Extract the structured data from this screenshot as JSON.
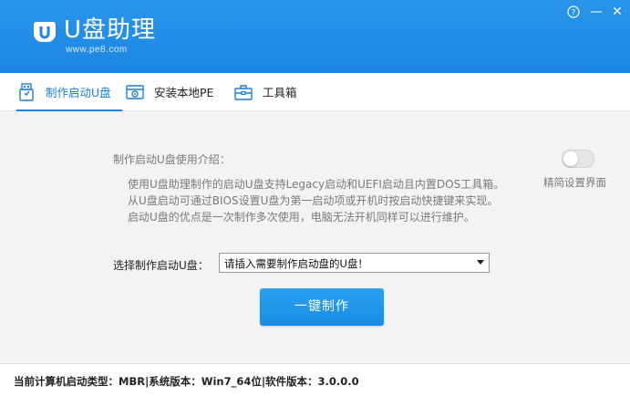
{
  "header": {
    "logo_text": "U盘助理",
    "logo_url": "www.pe8.com",
    "help_symbol": "?",
    "minimize_symbol": "—",
    "close_symbol": "✕"
  },
  "tabs": [
    {
      "label": "制作启动U盘",
      "icon": "usb-drive-icon",
      "active": true
    },
    {
      "label": "安装本地PE",
      "icon": "install-pe-icon",
      "active": false
    },
    {
      "label": "工具箱",
      "icon": "toolbox-icon",
      "active": false
    }
  ],
  "intro": {
    "title": "制作启动U盘使用介绍：",
    "lines": [
      "使用U盘助理制作的启动U盘支持Legacy启动和UEFI启动且内置DOS工具箱。",
      "从U盘启动可通过BIOS设置U盘为第一启动项或开机时按启动快捷键来实现。",
      "启动U盘的优点是一次制作多次使用，电脑无法开机同样可以进行维护。"
    ]
  },
  "toggle": {
    "label": "精简设置界面",
    "on": false
  },
  "select": {
    "label": "选择制作启动U盘：",
    "value": "请插入需要制作启动盘的U盘！"
  },
  "action_button": {
    "label": "一键制作"
  },
  "status": {
    "text": "当前计算机启动类型：MBR|系统版本：Win7_64位|软件版本：3.0.0.0"
  },
  "colors": {
    "header_blue": "#1d86e2",
    "accent_blue": "#1a7fd8",
    "background": "#f3f3f3"
  }
}
